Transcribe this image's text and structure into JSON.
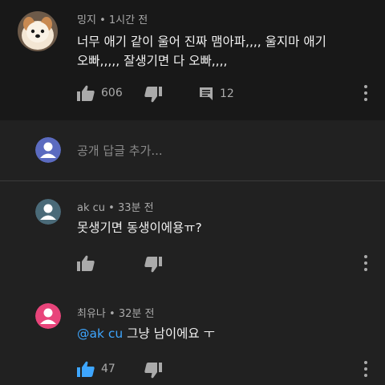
{
  "comment": {
    "author": "밍지",
    "time": "1시간 전",
    "lines": [
      "너무 애기 같이 울어 진짜 맴아파,,,, 울지마 애기",
      "오빠,,,,, 잘생기면 다 오빠,,,,"
    ],
    "likes": "606",
    "replies_count": "12"
  },
  "reply_input": {
    "placeholder": "공개 답글 추가..."
  },
  "replies": [
    {
      "author": "ak cu",
      "time": "33분 전",
      "text": "못생기면 동생이에용ㅠ?",
      "likes": ""
    },
    {
      "author": "최유나",
      "time": "32분 전",
      "mention": "@ak cu",
      "text": " 그냥 남이에요 ㅜ",
      "likes": "47"
    }
  ],
  "colors": {
    "background": "#212121",
    "top_background": "#181818",
    "link": "#3ea6ff",
    "avatar_blue": "#5b6bc0",
    "avatar_gray": "#4a6a78",
    "avatar_pink": "#e8447a"
  }
}
